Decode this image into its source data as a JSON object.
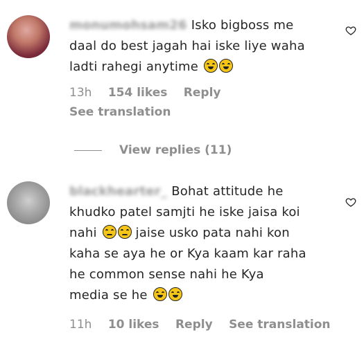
{
  "comments": [
    {
      "username": "monumohsam26",
      "text_line1": "Isko bigboss me",
      "text_line2": "daal do best jagah hai iske liye waha",
      "text_line3": "ladti rahegi anytime",
      "time": "13h",
      "likes": "154 likes",
      "reply": "Reply",
      "see_translation": "See translation",
      "view_replies": "View replies (11)",
      "emojis": [
        "laughing-emoji",
        "laughing-emoji"
      ]
    },
    {
      "username": "blackhearter_",
      "text_line1": "Bohat attitude he",
      "text_line2": "khudko patel samjti he iske jaisa koi",
      "text_line3_a": "nahi",
      "text_line3_b": "jaise usko pata nahi kon",
      "text_line4": "kaha se aya he or Kya kaam kar raha",
      "text_line5": "he common sense nahi he Kya",
      "text_line6": "media se he",
      "time": "11h",
      "likes": "10 likes",
      "reply": "Reply",
      "see_translation": "See translation",
      "emojis": [
        "unamused-emoji",
        "unamused-emoji",
        "rofl-emoji",
        "rofl-emoji"
      ]
    }
  ],
  "colors": {
    "text": "#262626",
    "muted": "#8e8e8e",
    "emoji_yellow": "#f5c518"
  }
}
